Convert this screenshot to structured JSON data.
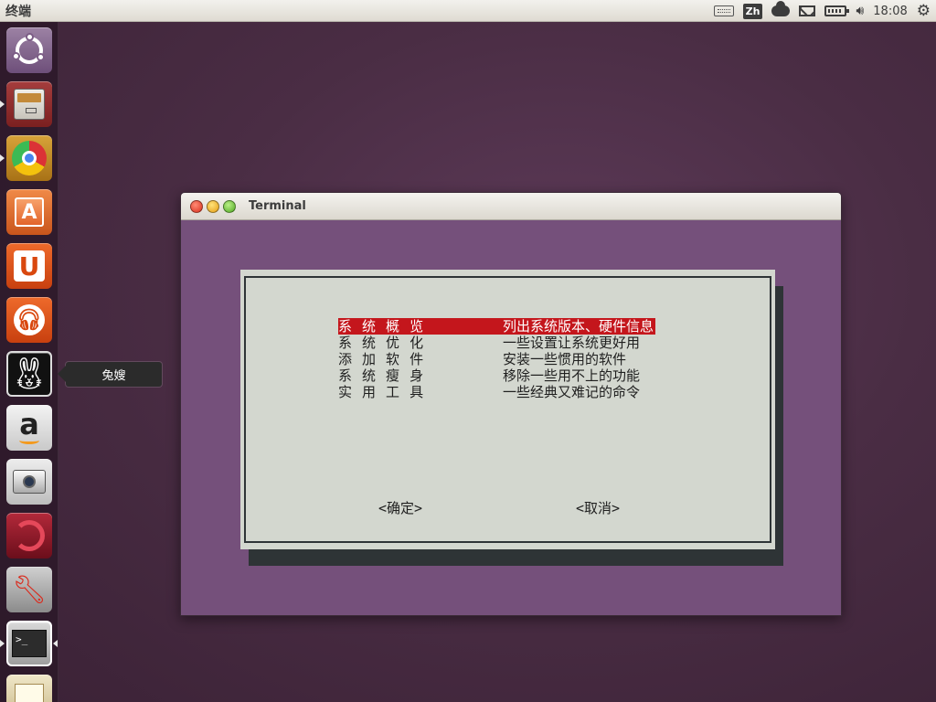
{
  "top_panel": {
    "app_title": "终端",
    "input_method": "Zh",
    "clock": "18:08"
  },
  "launcher": {
    "items": [
      {
        "name": "ubuntu-dash",
        "icon": "ubuntu-logo-icon"
      },
      {
        "name": "files",
        "icon": "file-cabinet-icon"
      },
      {
        "name": "chrome",
        "icon": "chrome-icon"
      },
      {
        "name": "software-center",
        "icon": "shopping-bag-icon",
        "glyph": "A"
      },
      {
        "name": "ubuntu-one",
        "icon": "ubuntu-one-icon",
        "glyph": "U"
      },
      {
        "name": "ubuntu-one-music",
        "icon": "headphones-icon"
      },
      {
        "name": "tusao",
        "icon": "bunny-icon"
      },
      {
        "name": "amazon",
        "icon": "amazon-icon",
        "glyph": "a"
      },
      {
        "name": "shotwell",
        "icon": "camera-icon"
      },
      {
        "name": "red-app",
        "icon": "swirl-icon"
      },
      {
        "name": "system-tools",
        "icon": "wrench-icon"
      },
      {
        "name": "terminal",
        "icon": "terminal-icon",
        "glyph": ">_"
      },
      {
        "name": "document",
        "icon": "document-icon"
      }
    ],
    "tooltip": "兔嫂"
  },
  "window": {
    "title": "Terminal"
  },
  "dialog": {
    "menu": [
      {
        "key": "系 统 概 览",
        "desc": "列出系统版本、硬件信息",
        "selected": true
      },
      {
        "key": "系 统 优 化",
        "desc": "一些设置让系统更好用",
        "selected": false
      },
      {
        "key": "添 加 软 件",
        "desc": "安装一些惯用的软件",
        "selected": false
      },
      {
        "key": "系 统 瘦 身",
        "desc": "移除一些用不上的功能",
        "selected": false
      },
      {
        "key": "实 用 工 具",
        "desc": "一些经典又难记的命令",
        "selected": false
      }
    ],
    "ok_label": "<确定>",
    "cancel_label": "<取消>"
  },
  "colors": {
    "selection": "#c4161c",
    "terminal_bg": "#75507b",
    "dialog_bg": "#d3d7cf"
  }
}
